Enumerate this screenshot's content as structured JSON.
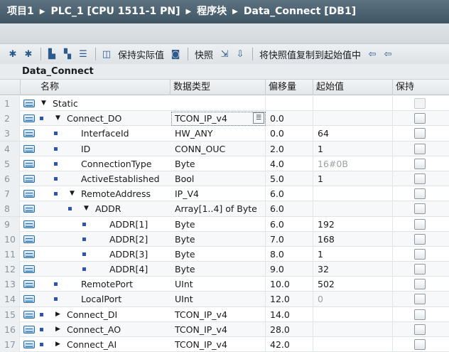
{
  "breadcrumb": [
    "项目1",
    "PLC_1 [CPU 1511-1 PN]",
    "程序块",
    "Data_Connect [DB1]"
  ],
  "breadcrumb_separator": "▶",
  "toolbar": {
    "keep_actual": "保持实际值",
    "snapshot": "快照",
    "copy_snapshot": "将快照值复制到起始值中"
  },
  "block_name": "Data_Connect",
  "columns": [
    "名称",
    "数据类型",
    "偏移量",
    "起始值",
    "保持"
  ],
  "rows": [
    {
      "num": "1",
      "level": 0,
      "expand": "down",
      "bullet": false,
      "name": "Static",
      "type": "",
      "offset": "",
      "start": "",
      "start_grey": false,
      "chk_dim": true
    },
    {
      "num": "2",
      "level": 1,
      "expand": "down",
      "bullet": true,
      "name": "Connect_DO",
      "type": "TCON_IP_v4",
      "offset": "0.0",
      "start": "",
      "start_grey": false,
      "chk_dim": false
    },
    {
      "num": "3",
      "level": 2,
      "expand": "",
      "bullet": true,
      "name": "InterfaceId",
      "type": "HW_ANY",
      "offset": "0.0",
      "start": "64",
      "start_grey": false,
      "chk_dim": false
    },
    {
      "num": "4",
      "level": 2,
      "expand": "",
      "bullet": true,
      "name": "ID",
      "type": "CONN_OUC",
      "offset": "2.0",
      "start": "1",
      "start_grey": false,
      "chk_dim": false
    },
    {
      "num": "5",
      "level": 2,
      "expand": "",
      "bullet": true,
      "name": "ConnectionType",
      "type": "Byte",
      "offset": "4.0",
      "start": "16#0B",
      "start_grey": true,
      "chk_dim": false
    },
    {
      "num": "6",
      "level": 2,
      "expand": "",
      "bullet": true,
      "name": "ActiveEstablished",
      "type": "Bool",
      "offset": "5.0",
      "start": "1",
      "start_grey": false,
      "chk_dim": false
    },
    {
      "num": "7",
      "level": 2,
      "expand": "down",
      "bullet": true,
      "name": "RemoteAddress",
      "type": "IP_V4",
      "offset": "6.0",
      "start": "",
      "start_grey": false,
      "chk_dim": false
    },
    {
      "num": "8",
      "level": 3,
      "expand": "down",
      "bullet": true,
      "name": "ADDR",
      "type": "Array[1..4] of Byte",
      "offset": "6.0",
      "start": "",
      "start_grey": false,
      "chk_dim": false
    },
    {
      "num": "9",
      "level": 4,
      "expand": "",
      "bullet": true,
      "name": "ADDR[1]",
      "type": "Byte",
      "offset": "6.0",
      "start": "192",
      "start_grey": false,
      "chk_dim": false
    },
    {
      "num": "10",
      "level": 4,
      "expand": "",
      "bullet": true,
      "name": "ADDR[2]",
      "type": "Byte",
      "offset": "7.0",
      "start": "168",
      "start_grey": false,
      "chk_dim": false
    },
    {
      "num": "11",
      "level": 4,
      "expand": "",
      "bullet": true,
      "name": "ADDR[3]",
      "type": "Byte",
      "offset": "8.0",
      "start": "1",
      "start_grey": false,
      "chk_dim": false
    },
    {
      "num": "12",
      "level": 4,
      "expand": "",
      "bullet": true,
      "name": "ADDR[4]",
      "type": "Byte",
      "offset": "9.0",
      "start": "32",
      "start_grey": false,
      "chk_dim": false
    },
    {
      "num": "13",
      "level": 2,
      "expand": "",
      "bullet": true,
      "name": "RemotePort",
      "type": "UInt",
      "offset": "10.0",
      "start": "502",
      "start_grey": false,
      "chk_dim": false
    },
    {
      "num": "14",
      "level": 2,
      "expand": "",
      "bullet": true,
      "name": "LocalPort",
      "type": "UInt",
      "offset": "12.0",
      "start": "0",
      "start_grey": true,
      "chk_dim": false
    },
    {
      "num": "15",
      "level": 1,
      "expand": "right",
      "bullet": true,
      "name": "Connect_DI",
      "type": "TCON_IP_v4",
      "offset": "14.0",
      "start": "",
      "start_grey": false,
      "chk_dim": false
    },
    {
      "num": "16",
      "level": 1,
      "expand": "right",
      "bullet": true,
      "name": "Connect_AO",
      "type": "TCON_IP_v4",
      "offset": "28.0",
      "start": "",
      "start_grey": false,
      "chk_dim": false
    },
    {
      "num": "17",
      "level": 1,
      "expand": "right",
      "bullet": true,
      "name": "Connect_AI",
      "type": "TCON_IP_v4",
      "offset": "42.0",
      "start": "",
      "start_grey": false,
      "chk_dim": false
    }
  ],
  "colors": {
    "title_bar": "#4a5f6e",
    "bullet": "#2f54b0",
    "db_icon": "#2d6b9a"
  }
}
